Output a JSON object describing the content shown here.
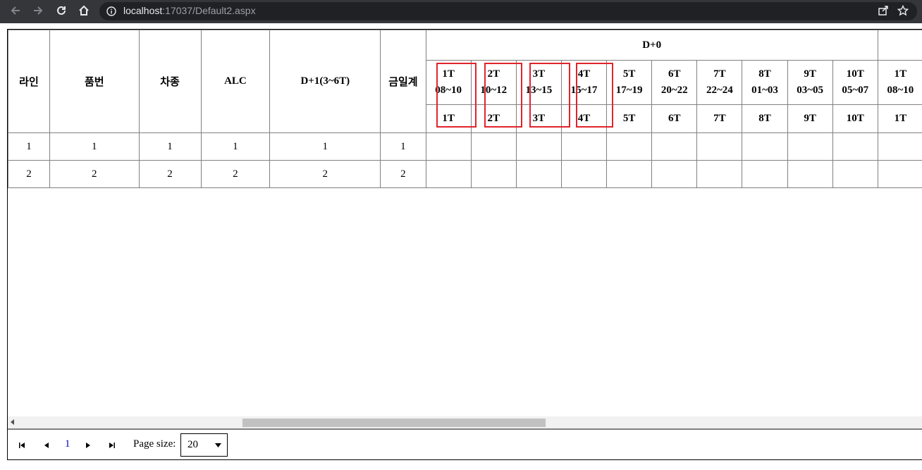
{
  "browser": {
    "url_host": "localhost",
    "url_rest": ":17037/Default2.aspx",
    "icons": [
      "back-icon",
      "forward-icon",
      "reload-icon",
      "home-icon",
      "info-icon",
      "share-icon",
      "star-icon"
    ]
  },
  "grid": {
    "headers": {
      "line": "라인",
      "part_no": "품번",
      "car_type": "차종",
      "alc": "ALC",
      "d1": "D+1(3~6T)",
      "today_total": "금일계",
      "d0": "D+0"
    },
    "time_slots": [
      {
        "code": "1T",
        "range": "08~10",
        "sub": "1T"
      },
      {
        "code": "2T",
        "range": "10~12",
        "sub": "2T"
      },
      {
        "code": "3T",
        "range": "13~15",
        "sub": "3T"
      },
      {
        "code": "4T",
        "range": "15~17",
        "sub": "4T"
      },
      {
        "code": "5T",
        "range": "17~19",
        "sub": "5T"
      },
      {
        "code": "6T",
        "range": "20~22",
        "sub": "6T"
      },
      {
        "code": "7T",
        "range": "22~24",
        "sub": "7T"
      },
      {
        "code": "8T",
        "range": "01~03",
        "sub": "8T"
      },
      {
        "code": "9T",
        "range": "03~05",
        "sub": "9T"
      },
      {
        "code": "10T",
        "range": "05~07",
        "sub": "10T"
      },
      {
        "code": "1T",
        "range": "08~10",
        "sub": "1T"
      }
    ],
    "rows": [
      {
        "line": "1",
        "part_no": "1",
        "car_type": "1",
        "alc": "1",
        "d1": "1",
        "today_total": "1"
      },
      {
        "line": "2",
        "part_no": "2",
        "car_type": "2",
        "alc": "2",
        "d1": "2",
        "today_total": "2"
      }
    ],
    "highlight_color": "#e0242b"
  },
  "pager": {
    "current_page": "1",
    "page_size_label": "Page size:",
    "page_size_value": "20"
  }
}
